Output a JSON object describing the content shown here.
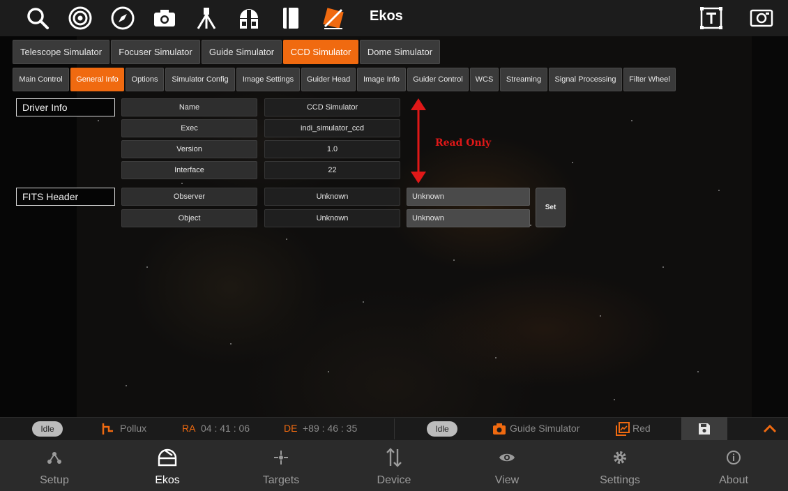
{
  "app": {
    "title": "Ekos"
  },
  "toolbar": {
    "icons": [
      "search-icon",
      "target-icon",
      "compass-icon",
      "camera-icon",
      "telescope-icon",
      "observatory-icon",
      "notebook-icon",
      "flip-icon",
      "text-frame-icon",
      "screenshot-icon"
    ]
  },
  "device_tabs": [
    "Telescope Simulator",
    "Focuser Simulator",
    "Guide Simulator",
    "CCD Simulator",
    "Dome Simulator"
  ],
  "device_tabs_active": "CCD Simulator",
  "group_tabs": [
    "Main Control",
    "General Info",
    "Options",
    "Simulator Config",
    "Image Settings",
    "Guider Head",
    "Image Info",
    "Guider Control",
    "WCS",
    "Streaming",
    "Signal Processing",
    "Filter Wheel"
  ],
  "group_tabs_active": "General Info",
  "driver_info": {
    "label": "Driver Info",
    "rows": [
      {
        "name": "Name",
        "value": "CCD Simulator"
      },
      {
        "name": "Exec",
        "value": "indi_simulator_ccd"
      },
      {
        "name": "Version",
        "value": "1.0"
      },
      {
        "name": "Interface",
        "value": "22"
      }
    ]
  },
  "fits_header": {
    "label": "FITS Header",
    "rows": [
      {
        "name": "Observer",
        "value": "Unknown",
        "input": "Unknown"
      },
      {
        "name": "Object",
        "value": "Unknown",
        "input": "Unknown"
      }
    ],
    "set_label": "Set"
  },
  "annotation": {
    "text": "Read Only",
    "color": "#e01818"
  },
  "status": {
    "mount_state": "Idle",
    "mount_target": "Pollux",
    "ra_label": "RA",
    "ra_value": "04 : 41 : 06",
    "de_label": "DE",
    "de_value": "+89 : 46 : 35",
    "camera_state": "Idle",
    "camera_name": "Guide Simulator",
    "filter_name": "Red"
  },
  "nav": [
    {
      "label": "Setup",
      "icon": "setup-icon"
    },
    {
      "label": "Ekos",
      "icon": "ekos-icon"
    },
    {
      "label": "Targets",
      "icon": "targets-icon"
    },
    {
      "label": "Device",
      "icon": "device-icon"
    },
    {
      "label": "View",
      "icon": "eye-icon"
    },
    {
      "label": "Settings",
      "icon": "gear-icon"
    },
    {
      "label": "About",
      "icon": "info-icon"
    }
  ],
  "nav_active": "Ekos",
  "colors": {
    "accent": "#f06a10",
    "annotation": "#e01818",
    "background": "#0d0c0b"
  }
}
